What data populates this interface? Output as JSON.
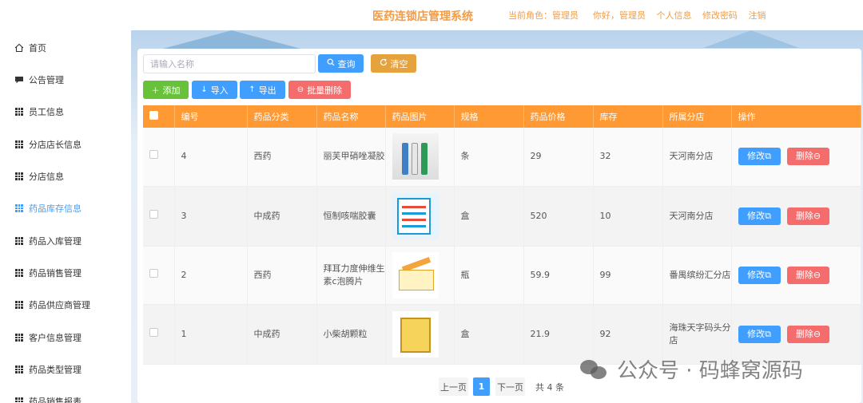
{
  "header": {
    "title": "医药连锁店管理系统",
    "role_text": "当前角色：管理员",
    "greeting": "你好，管理员",
    "profile": "个人信息",
    "change_password": "修改密码",
    "logout": "注销"
  },
  "sidebar": {
    "items": [
      {
        "label": "首页",
        "icon": "home-icon"
      },
      {
        "label": "公告管理",
        "icon": "chat-icon"
      },
      {
        "label": "员工信息",
        "icon": "grid-icon"
      },
      {
        "label": "分店店长信息",
        "icon": "grid-icon"
      },
      {
        "label": "分店信息",
        "icon": "grid-icon"
      },
      {
        "label": "药品库存信息",
        "icon": "grid-icon",
        "active": true
      },
      {
        "label": "药品入库管理",
        "icon": "grid-icon"
      },
      {
        "label": "药品销售管理",
        "icon": "grid-icon"
      },
      {
        "label": "药品供应商管理",
        "icon": "grid-icon"
      },
      {
        "label": "客户信息管理",
        "icon": "grid-icon"
      },
      {
        "label": "药品类型管理",
        "icon": "grid-icon"
      },
      {
        "label": "药品销售报表",
        "icon": "grid-icon"
      }
    ]
  },
  "toolbar": {
    "search_placeholder": "请输入名称",
    "query": "查询",
    "clear": "清空",
    "add": "添加",
    "import": "导入",
    "export": "导出",
    "batch_delete": "批量删除"
  },
  "table": {
    "headers": [
      "编号",
      "药品分类",
      "药品名称",
      "药品图片",
      "规格",
      "药品价格",
      "库存",
      "所属分店",
      "操作"
    ],
    "rows": [
      {
        "id": "4",
        "category": "西药",
        "name": "丽芙甲硝唑凝胶",
        "spec": "条",
        "price": "29",
        "stock": "32",
        "branch": "天河南分店",
        "image": "ointment-tubes"
      },
      {
        "id": "3",
        "category": "中成药",
        "name": "恒制咳喘胶囊",
        "spec": "盒",
        "price": "520",
        "stock": "10",
        "branch": "天河南分店",
        "image": "capsule-box"
      },
      {
        "id": "2",
        "category": "西药",
        "name": "拜耳力度伸维生素c泡腾片",
        "spec": "瓶",
        "price": "59.9",
        "stock": "99",
        "branch": "番禺缤纷汇分店",
        "image": "effervescent-tube"
      },
      {
        "id": "1",
        "category": "中成药",
        "name": "小柴胡颗粒",
        "spec": "盒",
        "price": "21.9",
        "stock": "92",
        "branch": "海珠天字码头分店",
        "image": "granule-box"
      }
    ],
    "edit_label": "修改",
    "delete_label": "删除"
  },
  "pagination": {
    "prev": "上一页",
    "current": "1",
    "next": "下一页",
    "total": "共 4 条"
  },
  "watermark": "公众号 · 码蜂窝源码",
  "colors": {
    "accent_orange": "#ff9933",
    "primary": "#409eff",
    "danger": "#f56c6c",
    "success": "#67c23a",
    "warning": "#e6a23c"
  }
}
